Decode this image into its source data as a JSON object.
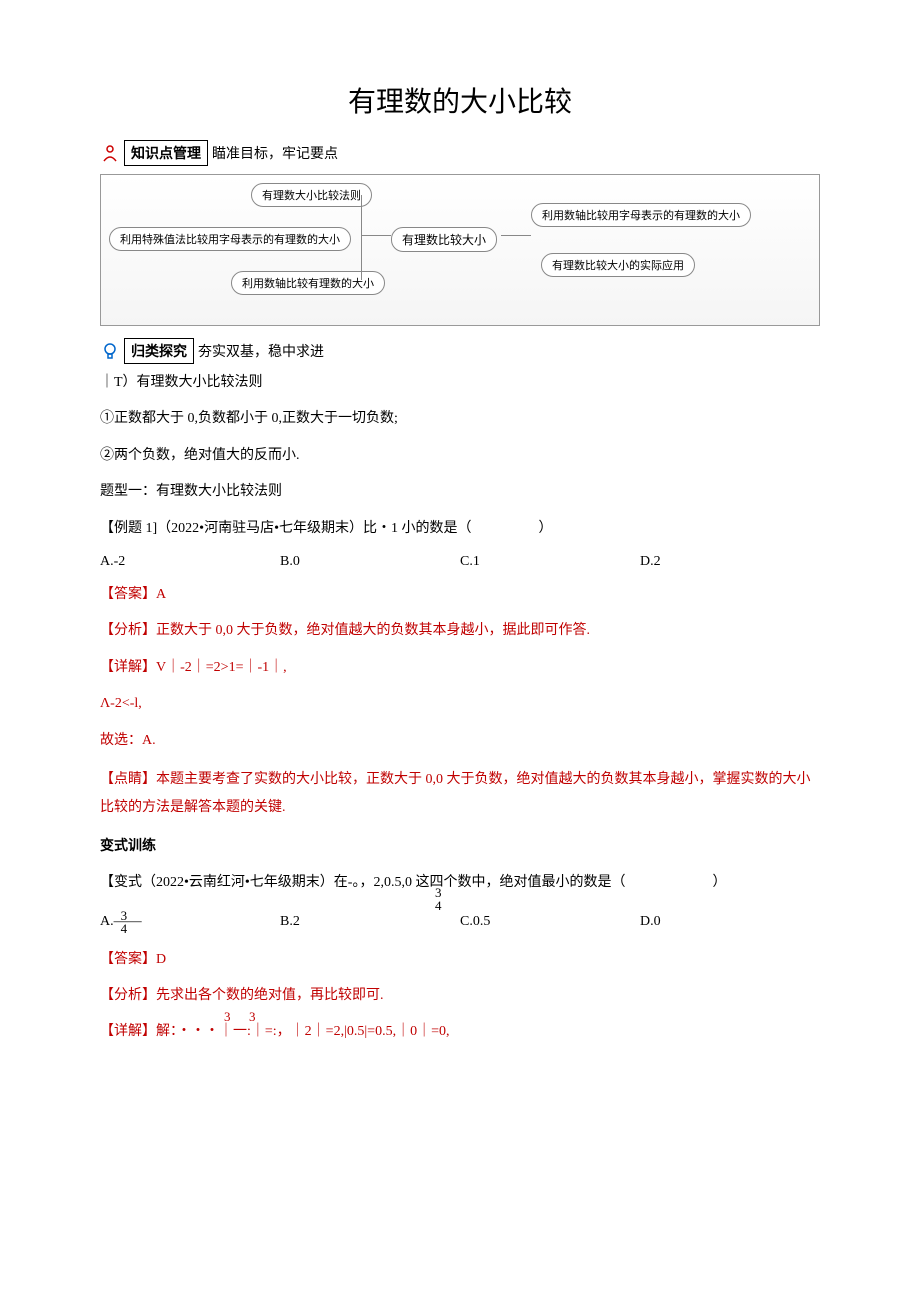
{
  "title": "有理数的大小比较",
  "section1": {
    "boxed": "知识点管理",
    "suffix": "瞄准目标，牢记要点"
  },
  "mindmap": {
    "center": "有理数比较大小",
    "left_top": "有理数大小比较法则",
    "left_mid": "利用特殊值法比较用字母表示的有理数的大小",
    "left_bot": "利用数轴比较有理数的大小",
    "right_top": "利用数轴比较用字母表示的有理数的大小",
    "right_bot": "有理数比较大小的实际应用"
  },
  "section2": {
    "boxed": "归类探究",
    "suffix": "夯实双基，稳中求进"
  },
  "concept_heading": "｜T）有理数大小比较法则",
  "rule1": "①正数都大于 0,负数都小于 0,正数大于一切负数;",
  "rule2": "②两个负数，绝对值大的反而小.",
  "type_heading": "题型一：有理数大小比较法则",
  "example1": {
    "prompt_prefix": "【例题 1]（2022•河南驻马店•七年级期末）比・1 小的数是（",
    "prompt_suffix": "）",
    "optA": "A.-2",
    "optB": "B.0",
    "optC": "C.1",
    "optD": "D.2",
    "answer": "【答案】A",
    "analysis": "【分析】正数大于 0,0 大于负数，绝对值越大的负数其本身越小，据此即可作答.",
    "detail": "【详解】V｜-2｜=2>1=｜-1｜,",
    "step2": "Λ-2<-l,",
    "conclude": "故选：A.",
    "point": "【点睛】本题主要考查了实数的大小比较，正数大于 0,0 大于负数，绝对值越大的负数其本身越小，掌握实数的大小比较的方法是解答本题的关键."
  },
  "variant_heading": "变式训练",
  "variant": {
    "prefix": "【变式（2022•云南红河•七年级期末）在-。，2,0.5,0 这四个数中，绝对值最小的数是（",
    "suffix": "）",
    "frac_top_num": "3",
    "frac_top_den": "4",
    "optA_prefix": "A.——",
    "optA_num": "3",
    "optA_den": "4",
    "optB": "B.2",
    "optC": "C.0.5",
    "optD": "D.0",
    "answer": "【答案】D",
    "analysis": "【分析】先求出各个数的绝对值，再比较即可.",
    "detail_prefix": "【详解】解：・・・｜一:｜=:，｜2｜=2,|0.5|=0.5,｜0｜=0,",
    "detail_num1": "3",
    "detail_num2": "3"
  }
}
